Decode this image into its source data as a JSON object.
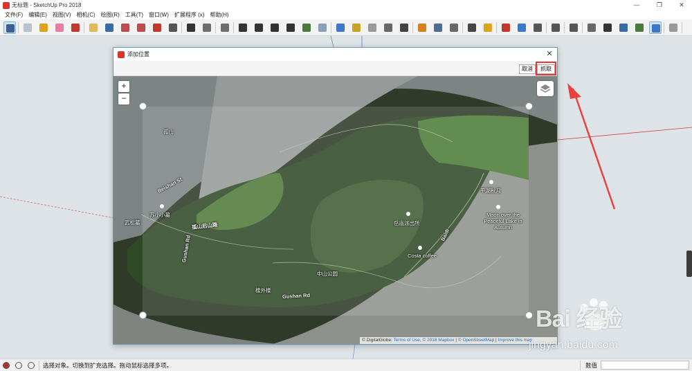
{
  "window": {
    "title": "无标题 - SketchUp Pro 2018",
    "controls": [
      "—",
      "❐",
      "✕"
    ]
  },
  "menu": [
    "文件(F)",
    "编辑(E)",
    "视图(V)",
    "相机(C)",
    "绘图(R)",
    "工具(T)",
    "窗口(W)",
    "扩展程序 (x)",
    "帮助(H)"
  ],
  "toolbar": {
    "icons": [
      {
        "name": "select-tool-icon",
        "color": "#3b5f8f"
      },
      {
        "name": "make-component-icon",
        "color": "#b8c2cc"
      },
      {
        "name": "paint-bucket-icon",
        "color": "#e0a21c"
      },
      {
        "name": "eraser-icon",
        "color": "#e57fa0"
      },
      {
        "name": "orbit-icon",
        "color": "#c0392b"
      },
      {
        "name": "pan-icon",
        "color": "#e3b75b"
      },
      {
        "name": "zoom-icon",
        "color": "#3a6da8"
      },
      {
        "name": "zoom-window-icon",
        "color": "#b94d4d"
      },
      {
        "name": "zoom-extents-icon",
        "color": "#b94d4d"
      },
      {
        "name": "position-camera-icon",
        "color": "#c0392b"
      },
      {
        "name": "look-around-icon",
        "color": "#555555"
      },
      {
        "name": "walk-icon",
        "color": "#333333"
      },
      {
        "name": "iso-view-icon",
        "color": "#6e6e6e"
      },
      {
        "name": "top-view-icon",
        "color": "#6e6e6e"
      },
      {
        "name": "front-view-icon",
        "color": "#333333"
      },
      {
        "name": "right-view-icon",
        "color": "#333333"
      },
      {
        "name": "back-view-icon",
        "color": "#333333"
      },
      {
        "name": "left-view-icon",
        "color": "#333333"
      },
      {
        "name": "add-location-icon",
        "color": "#4a7a3a"
      },
      {
        "name": "toggle-terrain-icon",
        "color": "#8aa0b8"
      },
      {
        "name": "photo-textures-icon",
        "color": "#3a78c8"
      },
      {
        "name": "measure-icon",
        "color": "#c9a227"
      },
      {
        "name": "camera-icon",
        "color": "#999999"
      },
      {
        "name": "sound-icon",
        "color": "#666666"
      },
      {
        "name": "3d-warehouse-icon",
        "color": "#444444"
      },
      {
        "name": "extension-warehouse-icon",
        "color": "#d4821f"
      },
      {
        "name": "layout-icon",
        "color": "#4b6c8f"
      },
      {
        "name": "styles-icon",
        "color": "#666666"
      },
      {
        "name": "sections-icon",
        "color": "#444444"
      },
      {
        "name": "shield-icon",
        "color": "#e0a21c"
      },
      {
        "name": "model-info-icon",
        "color": "#c0392b"
      },
      {
        "name": "xray-style-icon",
        "color": "#3a78c8"
      },
      {
        "name": "backedges-style-icon",
        "color": "#555555"
      },
      {
        "name": "wireframe-style-icon",
        "color": "#555555"
      },
      {
        "name": "hidden-line-style-icon",
        "color": "#555555"
      },
      {
        "name": "shaded-style-icon",
        "color": "#666666"
      },
      {
        "name": "shaded-texture-style-icon",
        "color": "#333333"
      },
      {
        "name": "monochrome-style-icon",
        "color": "#3a6da8"
      },
      {
        "name": "scenes-icon",
        "color": "#4a7a3a"
      },
      {
        "name": "sandbox-icon",
        "color": "#3a78c8"
      },
      {
        "name": "download-icon",
        "color": "#999999"
      }
    ]
  },
  "dialog": {
    "title": "添加位置",
    "close_label": "✕",
    "cancel_label": "取消",
    "grab_label": "抓取",
    "zoom_in_label": "+",
    "zoom_out_label": "−",
    "map_labels": [
      {
        "text": "Beishan St",
        "kind": "road"
      },
      {
        "text": "孤山",
        "kind": "place"
      },
      {
        "text": "苏小小墓",
        "kind": "poi"
      },
      {
        "text": "孤山后山路",
        "kind": "road"
      },
      {
        "text": "Gushan Rd",
        "kind": "road"
      },
      {
        "text": "楼外楼",
        "kind": "poi"
      },
      {
        "text": "中山公园",
        "kind": "poi"
      },
      {
        "text": "岳庙派出所",
        "kind": "poi"
      },
      {
        "text": "Costa coffee",
        "kind": "poi"
      },
      {
        "text": "平湖秋月",
        "kind": "poi"
      },
      {
        "text": "Moon over the Peaceful Lake in Autumn",
        "kind": "poi"
      },
      {
        "text": "Baidi",
        "kind": "road"
      },
      {
        "text": "武松墓",
        "kind": "poi"
      }
    ],
    "attribution": {
      "copy": "© DigitalGlobe:",
      "terms": "Terms of Use",
      "mapbox": "© 2018 Mapbox",
      "osm": "© OpenStreetMap",
      "improve": "Improve this map"
    }
  },
  "watermark": {
    "brand": "Bai 经验",
    "url": "jingyan.baidu.com"
  },
  "statusbar": {
    "message": "选择对象。切换到扩充选择。拖动鼠标选择多项。",
    "measure_label": "数值",
    "measure_value": ""
  }
}
